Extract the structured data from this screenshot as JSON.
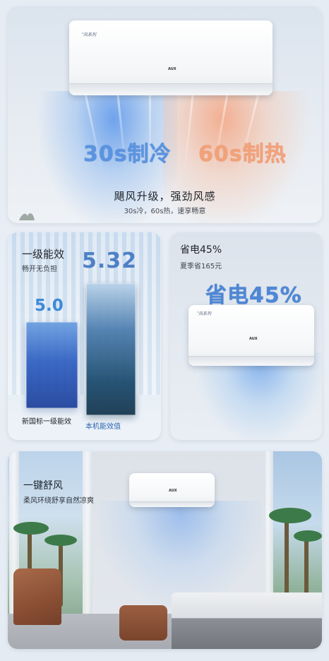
{
  "hero": {
    "ac_brand_line1": "ꩰ风系列",
    "ac_brand_line2": "AUX",
    "cooling_label": "30s制冷",
    "heating_label": "60s制热",
    "title": "飓风升级，强劲风感",
    "subtitle": "30s冷，60s热，速享畅意"
  },
  "efficiency": {
    "title": "一级能效",
    "subtitle": "畅开无负担",
    "national_value": "5.0",
    "unit_value": "5.32",
    "national_label": "新国标一级能效",
    "unit_label": "本机能效值"
  },
  "saving": {
    "title": "省电45%",
    "subtitle": "夏季省165元",
    "highlight": "省电45%",
    "ac_brand_line2": "AUX"
  },
  "comfort": {
    "title": "一键舒风",
    "subtitle": "柔风环绕舒享自然凉爽",
    "ac_brand_line2": "AUX"
  },
  "colors": {
    "cold": "#5b94e0",
    "hot": "#f2a27a",
    "accent_blue": "#4e87d6"
  }
}
